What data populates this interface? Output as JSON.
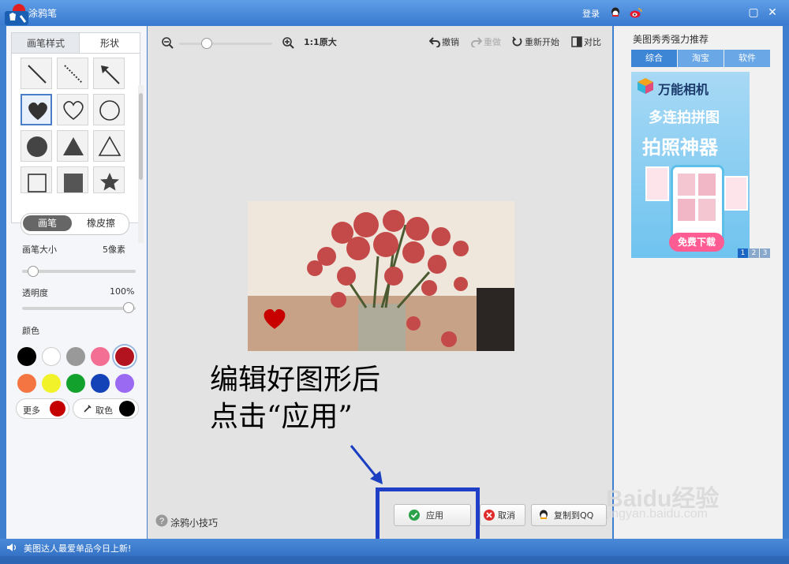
{
  "window": {
    "title": "涂鸦笔",
    "login_label": "登录"
  },
  "left_panel": {
    "tabs": [
      {
        "label": "画笔样式",
        "active": false
      },
      {
        "label": "形状",
        "active": true
      }
    ],
    "shapes": [
      "line-shape",
      "dashed-line-shape",
      "arrow-shape",
      "heart-filled-shape",
      "heart-outline-shape",
      "circle-outline-shape",
      "circle-filled-shape",
      "triangle-filled-shape",
      "triangle-outline-shape",
      "square-outline-shape",
      "square-filled-shape",
      "star-filled-shape"
    ],
    "mode": {
      "brush_label": "画笔",
      "eraser_label": "橡皮擦"
    },
    "brush_size": {
      "label": "画笔大小",
      "value": "5像素"
    },
    "opacity": {
      "label": "透明度",
      "value": "100%"
    },
    "color_label": "颜色",
    "palette": [
      "#000000",
      "#ffffff",
      "#999999",
      "#f36f93",
      "#b3121f",
      "#f47542",
      "#f2f22a",
      "#12a12d",
      "#1443b8",
      "#9a6af2"
    ],
    "more_label": "更多",
    "more_color": "#c40000",
    "pick_label": "取色",
    "pick_color": "#000000"
  },
  "toolbar": {
    "zoom_label": "1:1原大",
    "undo_label": "撤销",
    "redo_label": "重做",
    "restart_label": "重新开始",
    "compare_label": "对比"
  },
  "annotation": {
    "line1": "编辑好图形后",
    "line2": "点击“应用”"
  },
  "footer_canvas": {
    "tips_label": "涂鸦小技巧"
  },
  "buttons": {
    "apply_label": "应用",
    "cancel_label": "取消",
    "copy_label": "复制到QQ"
  },
  "right_panel": {
    "title": "美图秀秀强力推荐",
    "tabs": [
      "综合",
      "淘宝",
      "软件"
    ],
    "ad": {
      "brand": "万能相机",
      "line1": "多连拍拼图",
      "line2": "拍照神器",
      "button": "免费下载",
      "pages": [
        "1",
        "2",
        "3"
      ]
    }
  },
  "statusbar": {
    "text": "美图达人最爱单品今日上新!"
  },
  "watermark": {
    "brand": "Baidu经验",
    "url": "jingyan.baidu.com"
  }
}
